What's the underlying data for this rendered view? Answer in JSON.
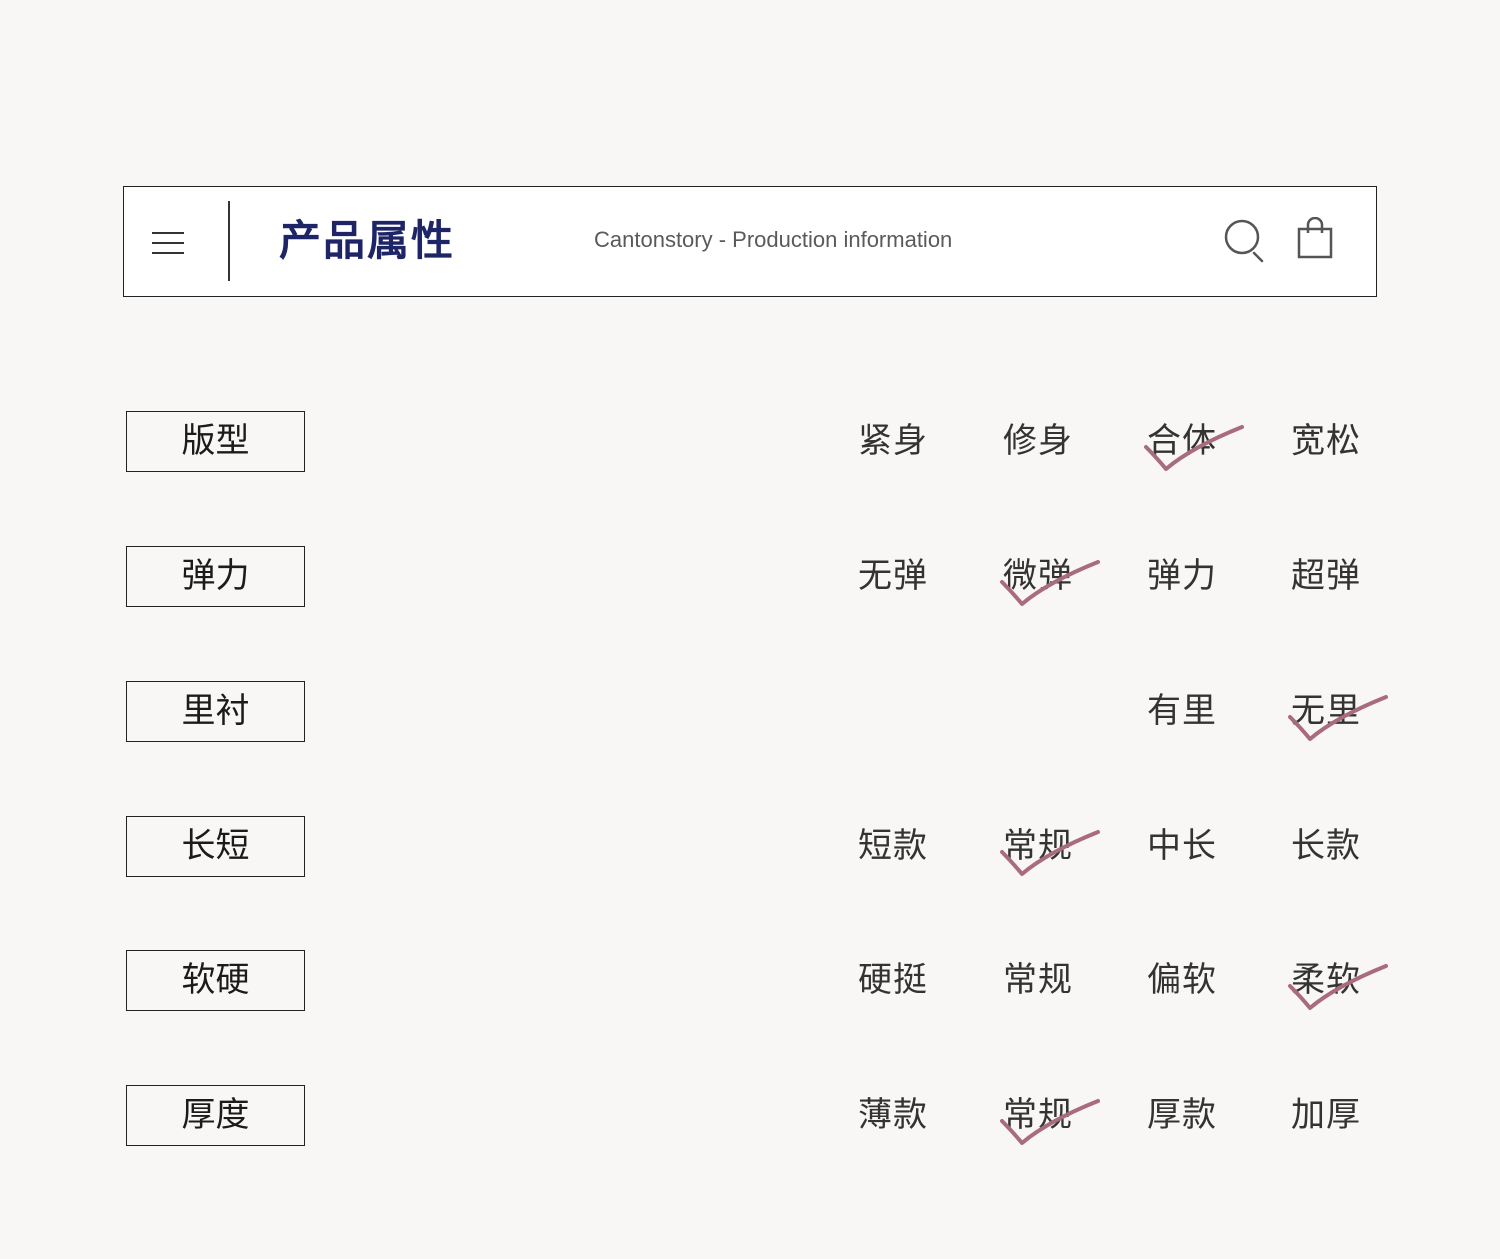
{
  "header": {
    "title": "产品属性",
    "subtitle": "Cantonstory - Production information",
    "icons": [
      "menu-icon",
      "search-icon",
      "shopping-bag-icon"
    ]
  },
  "colors": {
    "background": "#f9f7f5",
    "title": "#1e2566",
    "check_mark": "#a86b80"
  },
  "attributes": [
    {
      "label": "版型",
      "options": [
        "紧身",
        "修身",
        "合体",
        "宽松"
      ],
      "selected": "合体"
    },
    {
      "label": "弹力",
      "options": [
        "无弹",
        "微弹",
        "弹力",
        "超弹"
      ],
      "selected": "微弹"
    },
    {
      "label": "里衬",
      "options": [
        "有里",
        "无里"
      ],
      "selected": "无里"
    },
    {
      "label": "长短",
      "options": [
        "短款",
        "常规",
        "中长",
        "长款"
      ],
      "selected": "常规"
    },
    {
      "label": "软硬",
      "options": [
        "硬挺",
        "常规",
        "偏软",
        "柔软"
      ],
      "selected": "柔软"
    },
    {
      "label": "厚度",
      "options": [
        "薄款",
        "常规",
        "厚款",
        "加厚"
      ],
      "selected": "常规"
    }
  ]
}
